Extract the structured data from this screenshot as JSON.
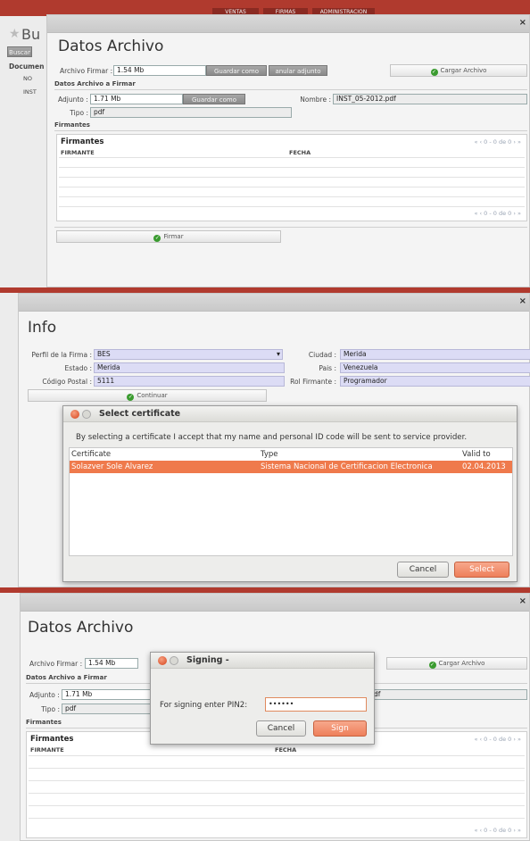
{
  "panel1": {
    "nav_tabs": [
      "VENTAS",
      "FIRMAS",
      "ADMINISTRACION"
    ],
    "bg_title": "Bu",
    "bg_buscar": "Buscar",
    "bg_documentos": "Documen",
    "bg_row1": "NO",
    "bg_row2": "INST",
    "close": "×",
    "title": "Datos Archivo",
    "archivo_firmar_label": "Archivo Firmar :",
    "archivo_firmar_value": "1.54 Mb",
    "guardar_como": "Guardar como",
    "anular_adjunto": "anular adjunto",
    "cargar_archivo": "Cargar Archivo",
    "section_datos": "Datos Archivo a Firmar",
    "adjunto_label": "Adjunto :",
    "adjunto_value": "1.71 Mb",
    "guardar_como2": "Guardar como",
    "nombre_label": "Nombre :",
    "nombre_value": "INST_05-2012.pdf",
    "tipo_label": "Tipo :",
    "tipo_value": "pdf",
    "section_firmantes": "Firmantes",
    "grid_title": "Firmantes",
    "pager": "« ‹ 0 - 0 de 0 › »",
    "col_firmante": "FIRMANTE",
    "col_fecha": "FECHA",
    "firmar": "Firmar"
  },
  "panel2": {
    "close": "×",
    "title": "Info",
    "perfil_label": "Perfil de la Firma :",
    "perfil_value": "BES",
    "ciudad_label": "Ciudad :",
    "ciudad_value": "Merida",
    "estado_label": "Estado :",
    "estado_value": "Merida",
    "pais_label": "Pais :",
    "pais_value": "Venezuela",
    "postal_label": "Código Postal :",
    "postal_value": "5111",
    "rol_label": "Rol Firmante :",
    "rol_value": "Programador",
    "continuar": "Continuar",
    "dialog_title": "Select certificate",
    "dialog_message": "By selecting a certificate I accept that my name and personal ID code will be sent to service provider.",
    "col_certificate": "Certificate",
    "col_type": "Type",
    "col_valid": "Valid to",
    "cert_name": "Solazver Sole Alvarez",
    "cert_type": "Sistema Nacional de Certificacion Electronica",
    "cert_valid": "02.04.2013",
    "cancel": "Cancel",
    "select": "Select"
  },
  "panel3": {
    "close": "×",
    "title": "Datos Archivo",
    "archivo_firmar_label": "Archivo Firmar :",
    "archivo_firmar_value": "1.54 Mb",
    "cargar_archivo": "Cargar Archivo",
    "section_datos": "Datos Archivo a Firmar",
    "adjunto_label": "Adjunto :",
    "adjunto_value": "1.71 Mb",
    "nombre_partial": "df",
    "tipo_label": "Tipo :",
    "tipo_value": "pdf",
    "section_firmantes": "Firmantes",
    "grid_title": "Firmantes",
    "pager": "« ‹ 0 - 0 de 0 › »",
    "col_firmante": "FIRMANTE",
    "col_fecha": "FECHA",
    "dialog_title": "Signing -",
    "pin_label": "For signing enter PIN2:",
    "pin_value": "••••••",
    "cancel": "Cancel",
    "sign": "Sign"
  }
}
